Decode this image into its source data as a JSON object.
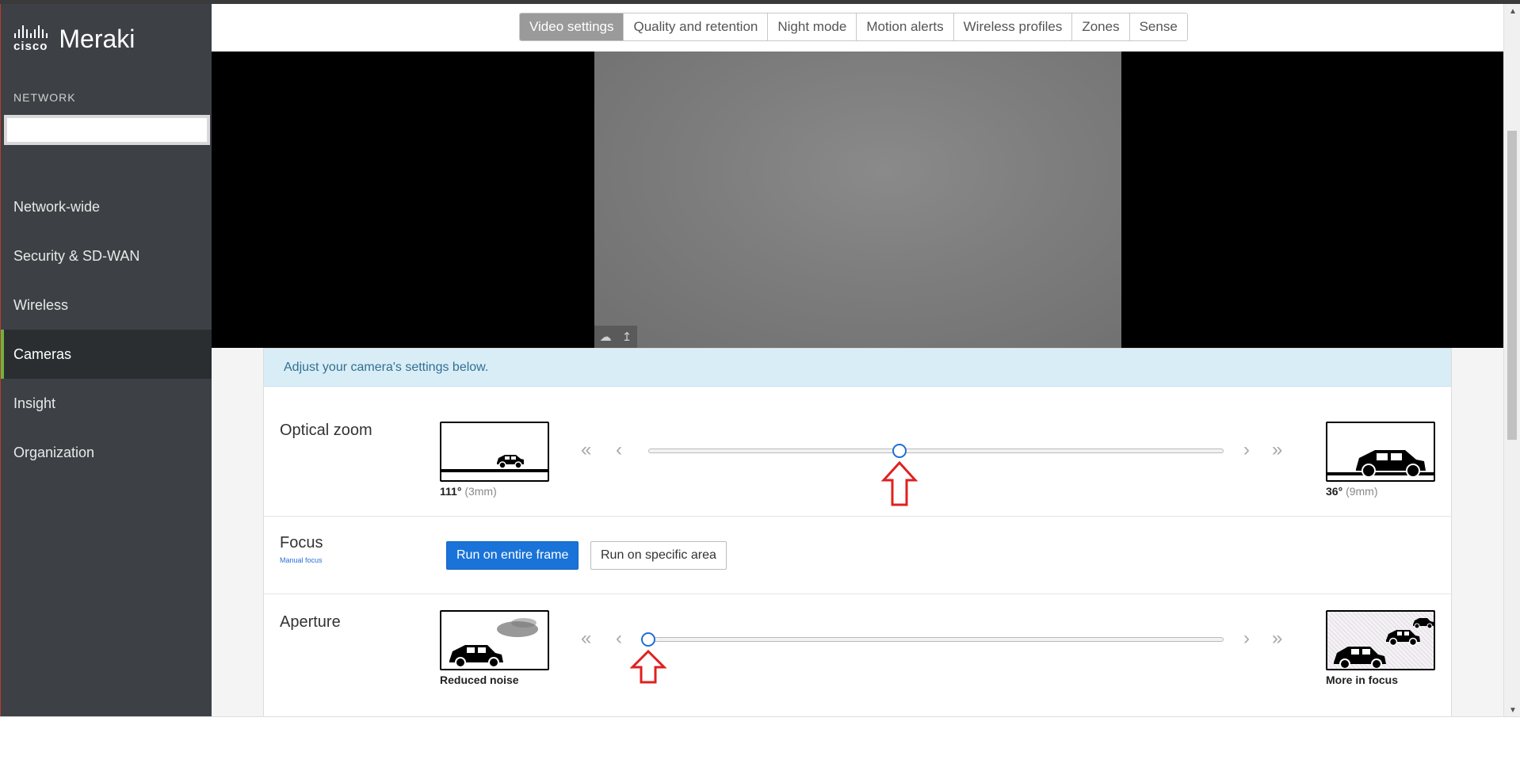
{
  "brand": {
    "cisco": "cisco",
    "product": "Meraki"
  },
  "sidebar": {
    "section_label": "NETWORK",
    "network_search_value": "",
    "items": [
      {
        "label": "Network-wide",
        "active": false
      },
      {
        "label": "Security & SD-WAN",
        "active": false
      },
      {
        "label": "Wireless",
        "active": false
      },
      {
        "label": "Cameras",
        "active": true
      },
      {
        "label": "Insight",
        "active": false
      },
      {
        "label": "Organization",
        "active": false
      }
    ]
  },
  "tabs": [
    {
      "label": "Video settings",
      "active": true
    },
    {
      "label": "Quality and retention",
      "active": false
    },
    {
      "label": "Night mode",
      "active": false
    },
    {
      "label": "Motion alerts",
      "active": false
    },
    {
      "label": "Wireless profiles",
      "active": false
    },
    {
      "label": "Zones",
      "active": false
    },
    {
      "label": "Sense",
      "active": false
    }
  ],
  "video": {
    "cloud_icon": "cloud-icon",
    "upload_icon": "arrow-up-icon"
  },
  "info_message": "Adjust your camera's settings below.",
  "optical_zoom": {
    "title": "Optical zoom",
    "left_caption_value": "111°",
    "left_caption_detail": "(3mm)",
    "right_caption_value": "36°",
    "right_caption_detail": "(9mm)",
    "slider_fraction": 0.437
  },
  "focus": {
    "title": "Focus",
    "subtitle": "Manual focus",
    "button_entire": "Run on entire frame",
    "button_specific": "Run on specific area"
  },
  "aperture": {
    "title": "Aperture",
    "left_caption": "Reduced noise",
    "right_caption": "More in focus",
    "slider_fraction": 0.0
  },
  "icons": {
    "fast_back": "«",
    "back": "‹",
    "forward": "›",
    "fast_forward": "»"
  },
  "colors": {
    "accent": "#1a73d8",
    "sidebar_bg": "#3d4145",
    "active_nav_bar": "#6cb33f",
    "arrow_red": "#e02020"
  }
}
